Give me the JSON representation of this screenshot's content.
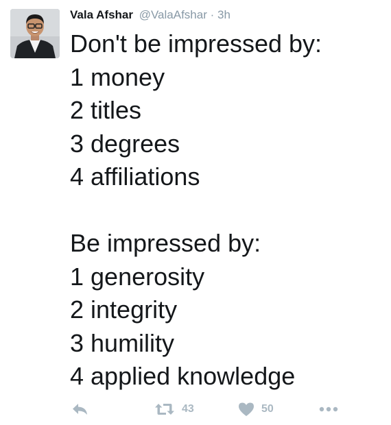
{
  "tweet": {
    "author": {
      "name": "Vala Afshar",
      "handle": "@ValaAfshar",
      "separator": "·",
      "time": "3h"
    },
    "lines": [
      "Don't be impressed by:",
      "1 money",
      "2 titles",
      "3 degrees",
      "4 affiliations",
      "",
      "Be impressed by:",
      "1 generosity",
      "2 integrity",
      "3 humility",
      "4 applied knowledge"
    ],
    "actions": {
      "reply_icon": "reply-icon",
      "retweet_icon": "retweet-icon",
      "retweet_count": "43",
      "like_icon": "heart-icon",
      "like_count": "50",
      "more_icon": "more-icon"
    }
  },
  "colors": {
    "text": "#14171a",
    "muted": "#8899a6",
    "action": "#aab8c2"
  }
}
